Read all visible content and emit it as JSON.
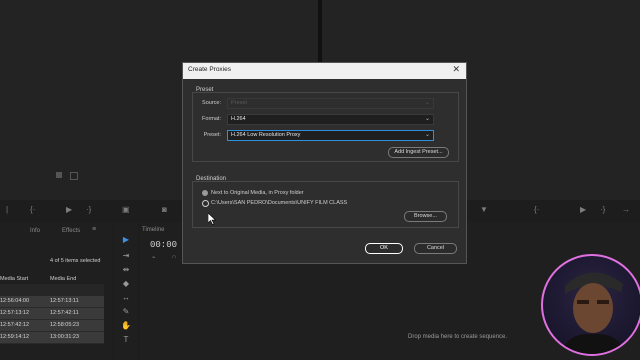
{
  "workspace": {
    "timeline_tab": "Timeline",
    "project_tabs": [
      "Info",
      "Effects"
    ],
    "items_selected": "4 of 5 items selected",
    "columns": [
      "Media Start",
      "Media End"
    ],
    "rows": [
      {
        "start": "12:56:04:00",
        "end": "12:57:13:11"
      },
      {
        "start": "12:57:13:12",
        "end": "12:57:42:11"
      },
      {
        "start": "12:57:42:12",
        "end": "12:58:05:23"
      },
      {
        "start": "12:59:14:12",
        "end": "13:00:31:23"
      }
    ],
    "timecode": "00:00",
    "drop_hint": "Drop media here to create sequence."
  },
  "dialog": {
    "title": "Create Proxies",
    "close_glyph": "✕",
    "preset_group": "Preset",
    "source_label": "Source:",
    "source_value": "Preset",
    "format_label": "Format:",
    "format_value": "H.264",
    "preset_label": "Preset:",
    "preset_value": "H.264 Low Resolution Proxy",
    "add_ingest_preset": "Add Ingest Preset...",
    "destination_group": "Destination",
    "dest_option_1": "Next to Original Media, in Proxy folder",
    "dest_option_2": "C:\\Users\\SAN PEDRO\\Documents\\UNIFY FILM CLASS",
    "browse": "Browse...",
    "ok": "OK",
    "cancel": "Cancel"
  },
  "colors": {
    "accent_focus": "#2f8fd8",
    "webcam_ring": "#e070e0"
  }
}
